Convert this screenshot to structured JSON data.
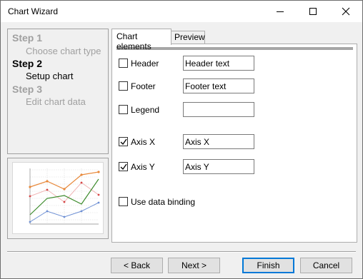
{
  "window": {
    "title": "Chart Wizard"
  },
  "steps": [
    {
      "title": "Step 1",
      "subtitle": "Choose chart type",
      "state": "inactive"
    },
    {
      "title": "Step 2",
      "subtitle": "Setup chart",
      "state": "active"
    },
    {
      "title": "Step 3",
      "subtitle": "Edit chart data",
      "state": "inactive"
    }
  ],
  "tabs": [
    {
      "label": "Chart elements",
      "selected": true
    },
    {
      "label": "Preview",
      "selected": false
    }
  ],
  "elements": {
    "header": {
      "label": "Header",
      "checked": false,
      "value": "Header text"
    },
    "footer": {
      "label": "Footer",
      "checked": false,
      "value": "Footer text"
    },
    "legend": {
      "label": "Legend",
      "checked": false,
      "value": ""
    },
    "axis_x": {
      "label": "Axis X",
      "checked": true,
      "value": "Axis X"
    },
    "axis_y": {
      "label": "Axis Y",
      "checked": true,
      "value": "Axis Y"
    },
    "data_binding": {
      "label": "Use data binding",
      "checked": false
    }
  },
  "buttons": {
    "back": "< Back",
    "next": "Next >",
    "finish": "Finish",
    "cancel": "Cancel"
  },
  "colors": {
    "inactive_step": "#a0a0a0",
    "default_button_border": "#0078d7",
    "series_orange": "#e8893b",
    "series_red": "#d64545",
    "series_green": "#3b8a2a",
    "series_blue": "#6d8fd4"
  }
}
